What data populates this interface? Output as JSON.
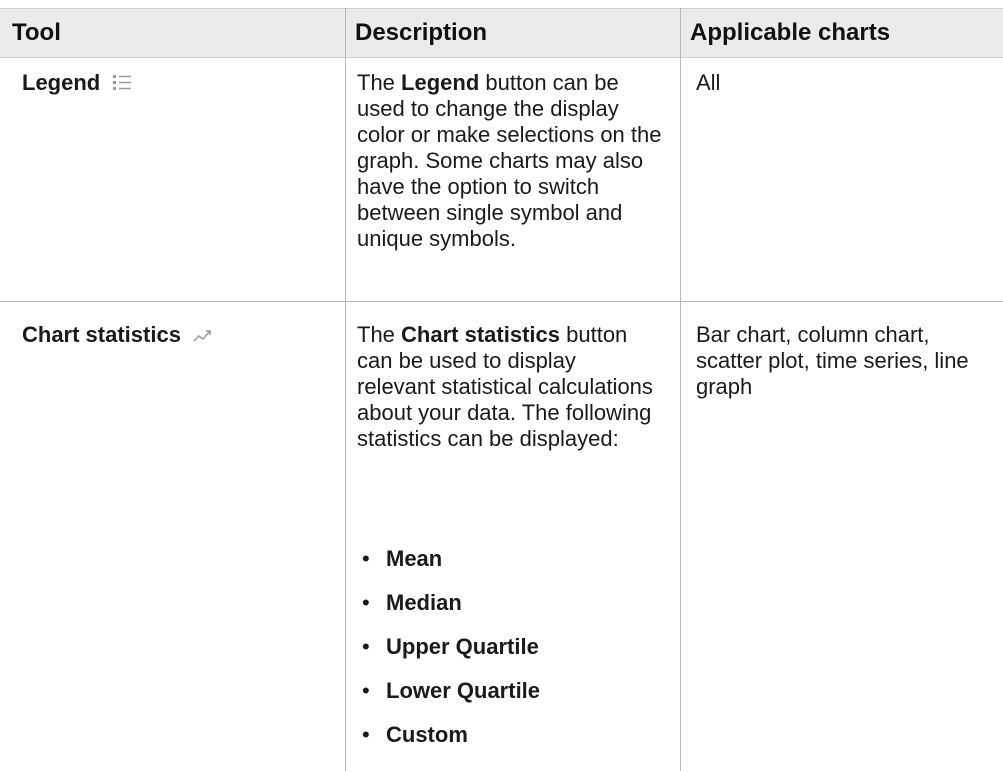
{
  "table": {
    "headers": {
      "tool": "Tool",
      "description": "Description",
      "applicable": "Applicable charts"
    },
    "rows": [
      {
        "tool_label": "Legend",
        "tool_icon": "legend-list-icon",
        "description_parts": {
          "lead": "The",
          "emph": "Legend",
          "rest": "button can be used to change the display color or make selections on the graph. Some charts may also have the option to switch between single symbol and unique symbols."
        },
        "applicable": "All"
      },
      {
        "tool_label": "Chart statistics",
        "tool_icon": "trend-line-icon",
        "description_parts": {
          "lead": "The",
          "emph": "Chart statistics",
          "rest": "button can be used to display relevant statistical calculations about your data. The following statistics can be displayed:"
        },
        "statistics": [
          "Mean",
          "Median",
          "Upper Quartile",
          "Lower Quartile",
          "Custom"
        ],
        "bullet_glyph": "•",
        "applicable": "Bar chart, column chart, scatter plot, time series, line graph"
      }
    ]
  },
  "colors": {
    "header_bg": "#ebebeb",
    "border": "#b8b8b8",
    "icon_gray": "#9a9a9a"
  }
}
